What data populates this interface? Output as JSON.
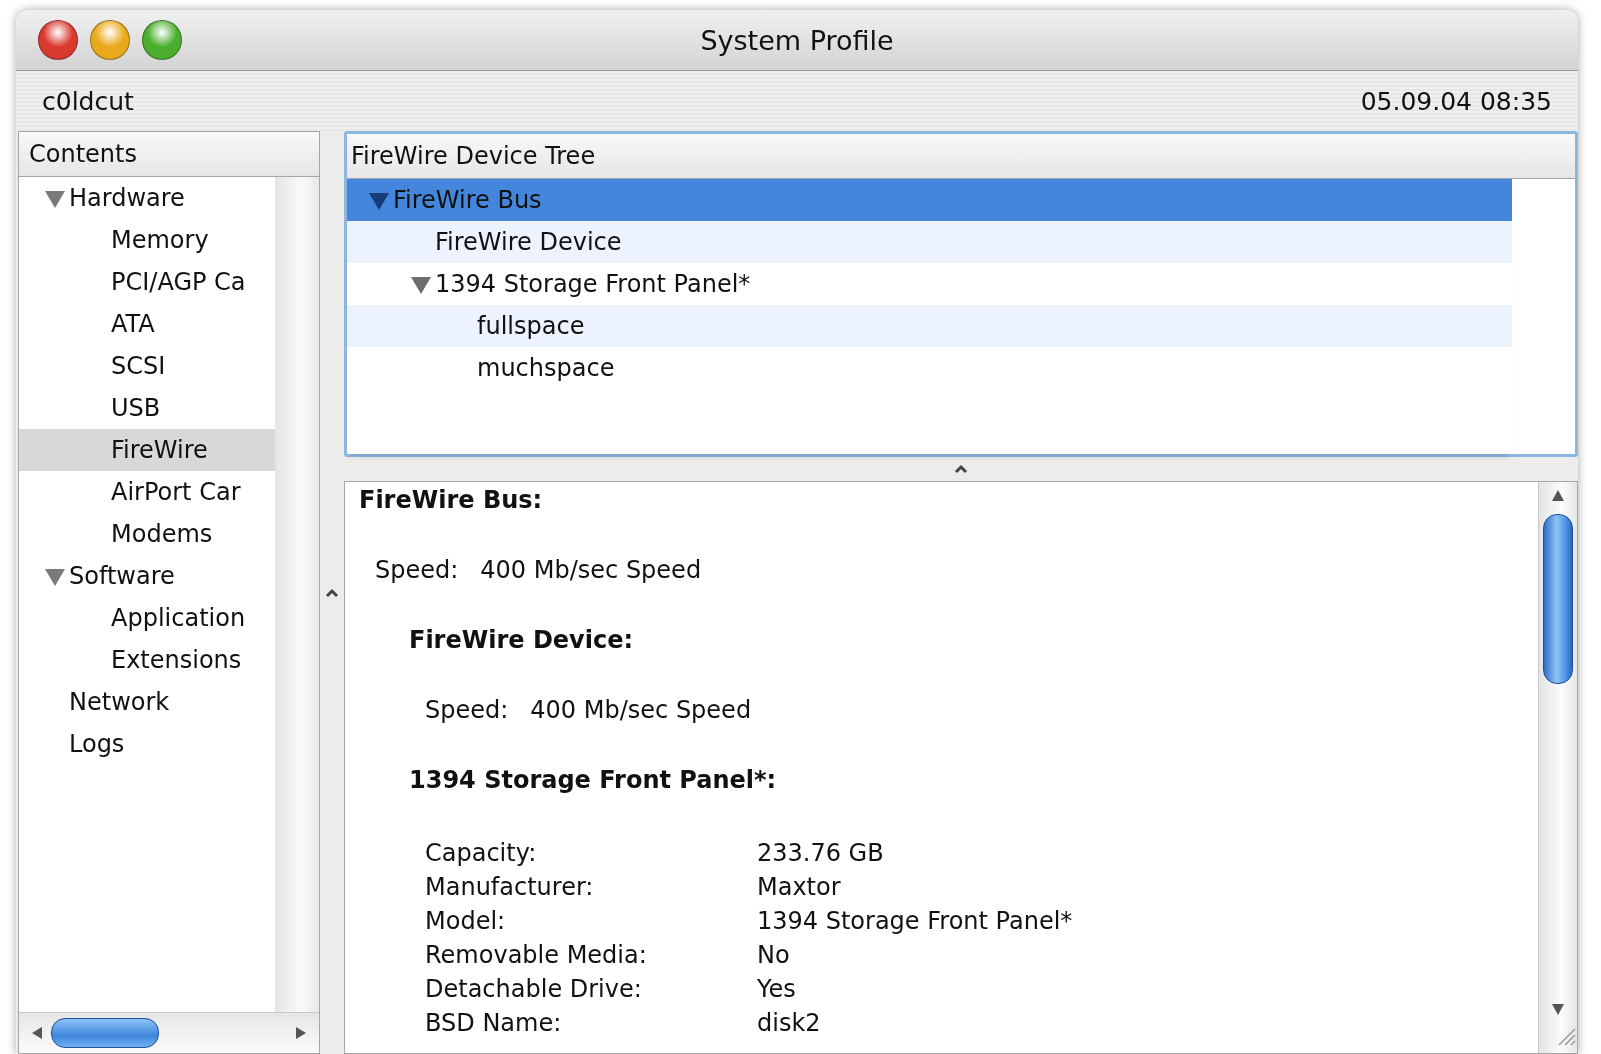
{
  "window": {
    "title": "System Profile"
  },
  "toolbar": {
    "computer_name": "c0ldcut",
    "timestamp": "05.09.04 08:35"
  },
  "sidebar": {
    "header": "Contents",
    "items": [
      {
        "label": "Hardware",
        "expanded": true,
        "selected": false,
        "children": [
          {
            "label": "Memory",
            "selected": false
          },
          {
            "label": "PCI/AGP Ca",
            "selected": false
          },
          {
            "label": "ATA",
            "selected": false
          },
          {
            "label": "SCSI",
            "selected": false
          },
          {
            "label": "USB",
            "selected": false
          },
          {
            "label": "FireWire",
            "selected": true
          },
          {
            "label": "AirPort Car",
            "selected": false
          },
          {
            "label": "Modems",
            "selected": false
          }
        ]
      },
      {
        "label": "Software",
        "expanded": true,
        "selected": false,
        "children": [
          {
            "label": "Application",
            "selected": false
          },
          {
            "label": "Extensions",
            "selected": false
          }
        ]
      },
      {
        "label": "Network",
        "selected": false
      },
      {
        "label": "Logs",
        "selected": false
      }
    ]
  },
  "device_tree": {
    "header": "FireWire Device Tree",
    "rows": [
      {
        "label": "FireWire Bus",
        "expanded": true,
        "selected": true,
        "children": [
          {
            "label": "FireWire Device",
            "selected": false
          },
          {
            "label": "1394 Storage Front Panel*",
            "expanded": true,
            "selected": false,
            "children": [
              {
                "label": "fullspace",
                "selected": false
              },
              {
                "label": "muchspace",
                "selected": false
              }
            ]
          }
        ]
      }
    ]
  },
  "details": {
    "title": "FireWire Bus:",
    "kind": "inline",
    "fields": [
      {
        "label": "Speed:",
        "value": "400 Mb/sec Speed"
      }
    ],
    "children": [
      {
        "title": "FireWire Device:",
        "kind": "inline",
        "fields": [
          {
            "label": "Speed:",
            "value": "400 Mb/sec Speed"
          }
        ]
      },
      {
        "title": "1394 Storage Front Panel*:",
        "kind": "table",
        "fields": [
          {
            "label": "Capacity:",
            "value": "233.76 GB"
          },
          {
            "label": "Manufacturer:",
            "value": "Maxtor"
          },
          {
            "label": "Model:",
            "value": "1394 Storage Front Panel*"
          },
          {
            "label": "Removable Media:",
            "value": "No"
          },
          {
            "label": "Detachable Drive:",
            "value": "Yes"
          },
          {
            "label": "BSD Name:",
            "value": "disk2"
          }
        ]
      }
    ]
  }
}
